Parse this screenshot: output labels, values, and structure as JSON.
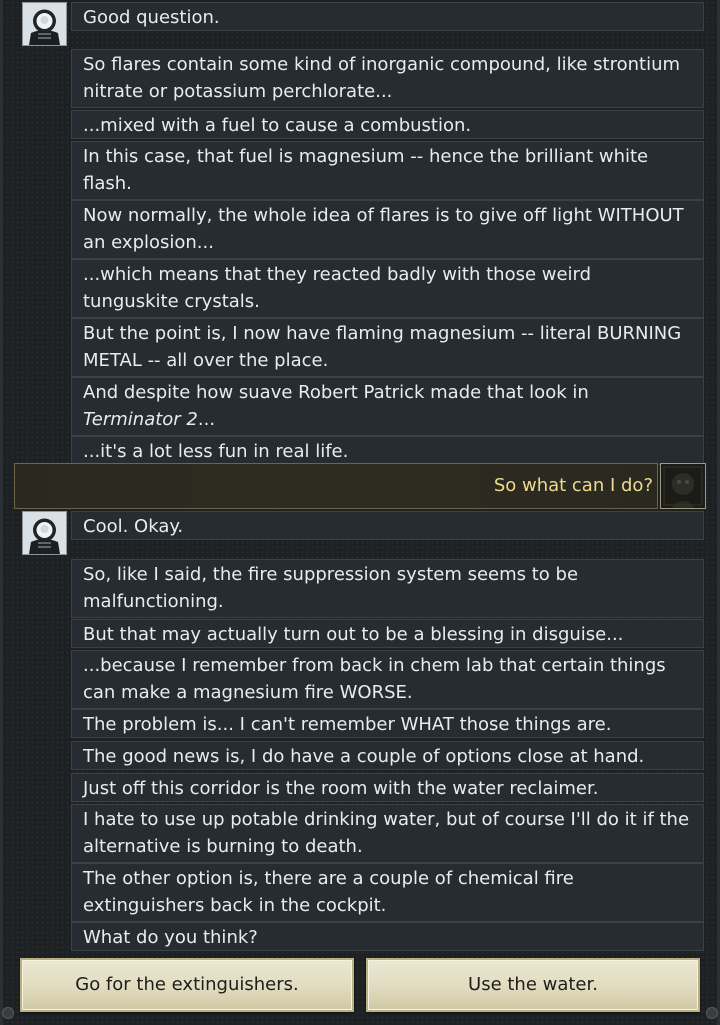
{
  "conversation": {
    "block1": [
      {
        "lines": [
          "Good question."
        ]
      },
      {
        "lines": [
          "So flares contain some kind of inorganic compound, like strontium",
          "nitrate or potassium perchlorate..."
        ]
      },
      {
        "lines": [
          "...mixed with a fuel to cause a combustion."
        ]
      },
      {
        "lines": [
          "In this case, that fuel is magnesium -- hence the brilliant white",
          "flash."
        ]
      },
      {
        "lines": [
          "Now normally, the whole idea of flares is to give off light WITHOUT",
          "an explosion..."
        ]
      },
      {
        "lines": [
          "...which means that they reacted badly with those weird",
          "tunguskite crystals."
        ]
      },
      {
        "lines": [
          "But the point is, I now have flaming magnesium -- literal BURNING",
          "METAL -- all over the place."
        ]
      },
      {
        "lines": [
          "And despite how suave Robert Patrick made that look in"
        ],
        "italic": "Terminator 2",
        "after_italic": "..."
      },
      {
        "lines": [
          "...it's a lot less fun in real life."
        ]
      }
    ],
    "player_message": "So what can I do?",
    "block2": [
      {
        "lines": [
          "Cool. Okay."
        ]
      },
      {
        "lines": [
          "So, like I said, the fire suppression system seems to be",
          "malfunctioning."
        ]
      },
      {
        "lines": [
          "But that may actually turn out to be a blessing in disguise..."
        ]
      },
      {
        "lines": [
          "...because I remember from back in chem lab that certain things",
          "can make a magnesium fire WORSE."
        ]
      },
      {
        "lines": [
          "The problem is... I can't remember WHAT those things are."
        ]
      },
      {
        "lines": [
          "The good news is, I do have a couple of options close at hand."
        ]
      },
      {
        "lines": [
          "Just off this corridor is the room with the water reclaimer."
        ]
      },
      {
        "lines": [
          "I hate to use up potable drinking water, but of course I'll do it if the",
          "alternative is burning to death."
        ]
      },
      {
        "lines": [
          "The other option is, there are a couple of chemical fire",
          "extinguishers back in the cockpit."
        ]
      },
      {
        "lines": [
          "What do you think?"
        ]
      }
    ]
  },
  "choices": {
    "left": "Go for the extinguishers.",
    "right": "Use the water."
  },
  "icons": {
    "npc_portrait": "astronaut-portrait-icon",
    "player_portrait": "player-portrait-icon"
  },
  "colors": {
    "npc_text": "#e7ecef",
    "player_text": "#efd98e",
    "choice_bg": "#e1dcc0"
  }
}
